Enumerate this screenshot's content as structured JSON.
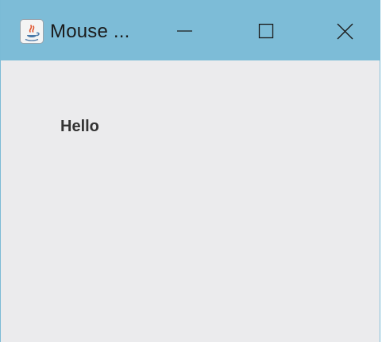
{
  "window": {
    "title": "Mouse ...",
    "app_icon": "java-icon",
    "controls": {
      "minimize_icon": "minimize-icon",
      "maximize_icon": "maximize-icon",
      "close_icon": "close-icon"
    }
  },
  "content": {
    "label": "Hello"
  },
  "colors": {
    "titlebar": "#7dbcd7",
    "content_background": "#ebebed",
    "label_text": "#333333"
  }
}
